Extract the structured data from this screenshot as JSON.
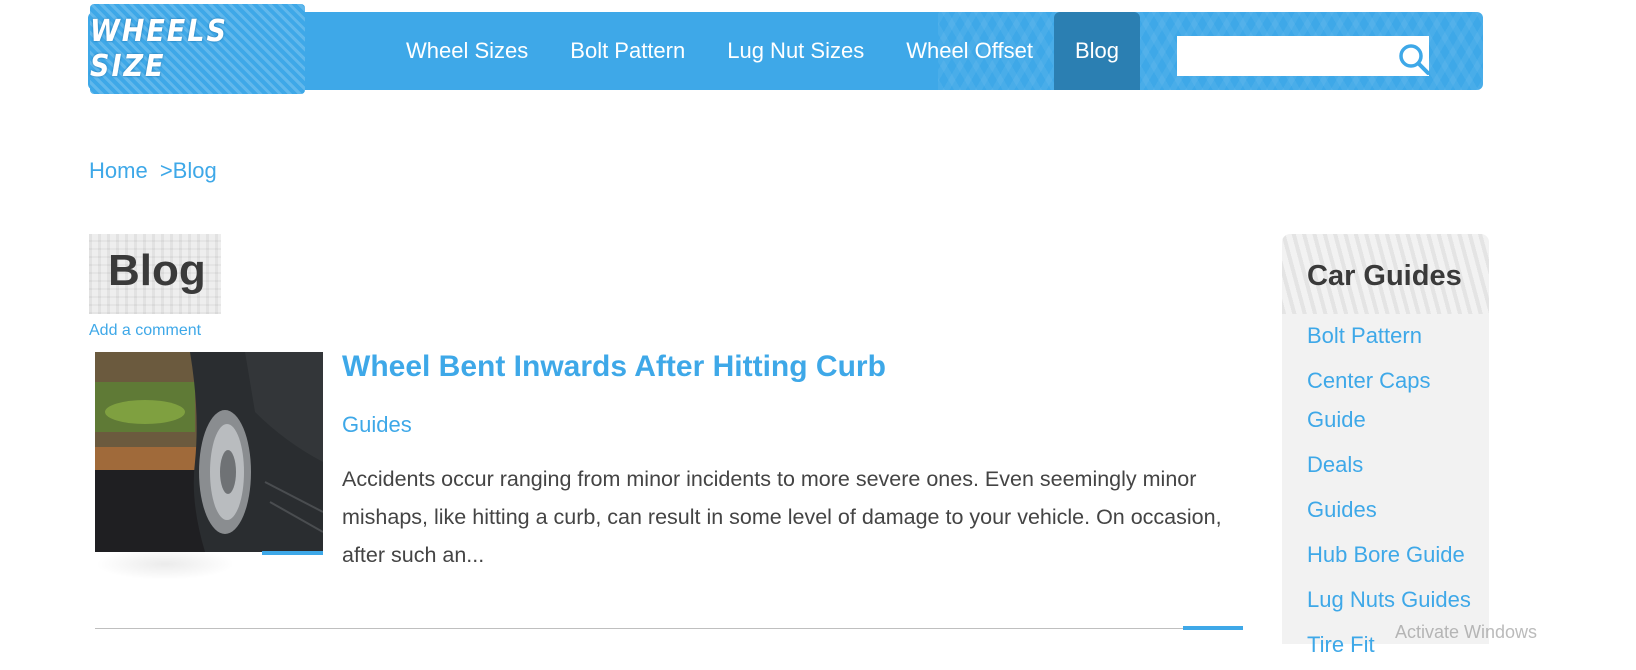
{
  "site": {
    "logo_text": "WHEELS SIZE",
    "brand_color": "#3ea8e8",
    "active_color": "#2b7fb2"
  },
  "nav": {
    "items": [
      {
        "label": "Wheel Sizes"
      },
      {
        "label": "Bolt Pattern"
      },
      {
        "label": "Lug Nut Sizes"
      },
      {
        "label": "Wheel Offset"
      },
      {
        "label": "Blog",
        "active": true
      }
    ]
  },
  "search": {
    "value": "",
    "icon": "search-icon"
  },
  "breadcrumb": {
    "home": "Home",
    "separator": ">",
    "current": "Blog"
  },
  "page": {
    "title": "Blog",
    "add_comment": "Add a comment"
  },
  "post": {
    "title": "Wheel Bent Inwards After Hitting Curb",
    "category": "Guides",
    "excerpt": "Accidents occur ranging from minor incidents to more severe ones. Even seemingly minor mishaps, like hitting a curb, can result in some level of damage to your vehicle. On occasion, after such an..."
  },
  "sidebar": {
    "heading": "Car Guides",
    "items": [
      {
        "label": "Bolt Pattern"
      },
      {
        "label": "Center Caps Guide"
      },
      {
        "label": "Deals"
      },
      {
        "label": "Guides"
      },
      {
        "label": "Hub Bore Guide"
      },
      {
        "label": "Lug Nuts Guides"
      },
      {
        "label": "Tire Fit"
      }
    ]
  },
  "overlay": {
    "watermark": "Activate Windows"
  }
}
